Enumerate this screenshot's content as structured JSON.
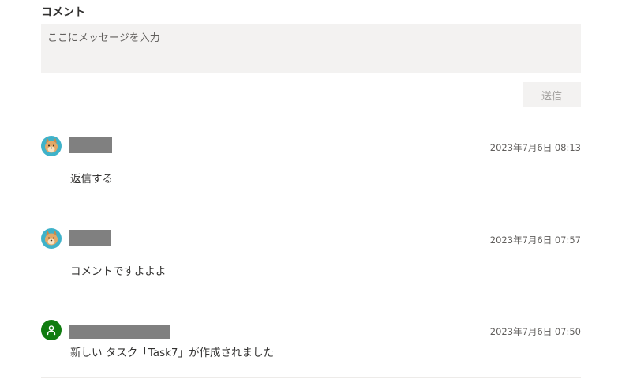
{
  "comments": {
    "heading": "コメント",
    "input_placeholder": "ここにメッセージを入力",
    "send_label": "送信",
    "items": [
      {
        "avatar": "dog-avatar",
        "author_redacted": true,
        "timestamp": "2023年7月6日 08:13",
        "message": "返信する"
      },
      {
        "avatar": "dog-avatar",
        "author_redacted": true,
        "timestamp": "2023年7月6日 07:57",
        "message": "コメントですよよよ"
      },
      {
        "avatar": "person-icon",
        "author_redacted": true,
        "timestamp": "2023年7月6日 07:50",
        "message": "新しい タスク「Task7」が作成されました"
      }
    ]
  },
  "colors": {
    "input_bg": "#f3f2f1",
    "system_avatar": "#107c10",
    "dog_avatar_bg": "#3fb2c9",
    "redaction": "#808080"
  }
}
